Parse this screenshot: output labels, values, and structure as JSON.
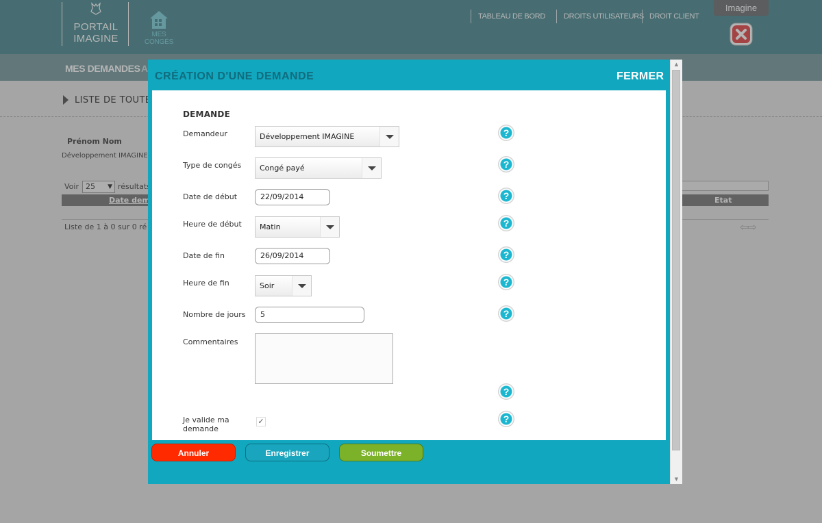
{
  "app": {
    "logo_line1": "PORTAIL",
    "logo_line2": "IMAGINE",
    "section_label": "MES CONGÉS",
    "user": "Imagine"
  },
  "topnav": [
    {
      "label": "TABLEAU DE BORD"
    },
    {
      "label": "DROITS UTILISATEURS"
    },
    {
      "label": "DROIT CLIENT"
    }
  ],
  "subnav": {
    "title": "MES DEMANDES",
    "extra": "A"
  },
  "background": {
    "list_title": "LISTE DE TOUTE",
    "name_header": "Prénom Nom",
    "name_value": "Développement IMAGINE",
    "show_label": "Voir",
    "show_value": "25",
    "result_label": "résultats",
    "col_date": "Date dem",
    "col_state": "Etat",
    "info": "Liste de 1 à 0 sur 0 ré"
  },
  "modal": {
    "title": "CRÉATION D'UNE DEMANDE",
    "close": "FERMER",
    "section": "DEMANDE",
    "fields": {
      "demandeur": {
        "label": "Demandeur",
        "value": "Développement IMAGINE"
      },
      "type": {
        "label": "Type de congés",
        "value": "Congé payé"
      },
      "date_debut": {
        "label": "Date de début",
        "value": "22/09/2014"
      },
      "heure_debut": {
        "label": "Heure de début",
        "value": "Matin"
      },
      "date_fin": {
        "label": "Date de fin",
        "value": "26/09/2014"
      },
      "heure_fin": {
        "label": "Heure de fin",
        "value": "Soir"
      },
      "nb_jours": {
        "label": "Nombre de jours",
        "value": "5"
      },
      "commentaires": {
        "label": "Commentaires",
        "value": ""
      },
      "valide": {
        "label": "Je valide ma demande",
        "checked": true
      }
    },
    "help_glyph": "?",
    "buttons": {
      "cancel": "Annuler",
      "save": "Enregistrer",
      "submit": "Soumettre"
    }
  },
  "colors": {
    "header": "#4e8c93",
    "modal": "#11a7bf",
    "cancel": "#ff2a00",
    "save": "#18a5bd",
    "submit": "#7cb22a"
  }
}
